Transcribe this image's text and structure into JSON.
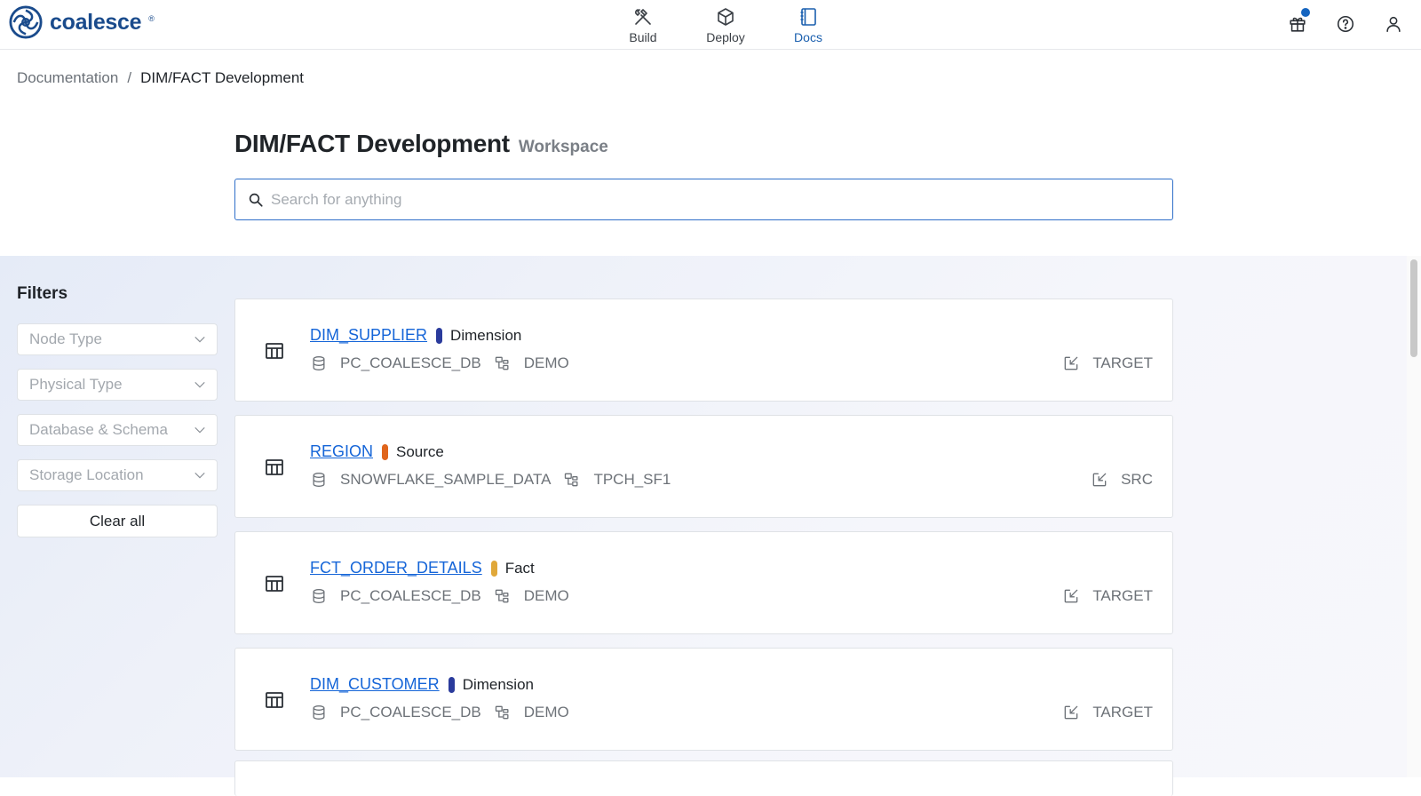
{
  "brand": {
    "name": "coalesce",
    "reg": "®"
  },
  "nav": [
    {
      "label": "Build",
      "icon": "hammer-wrench-icon",
      "active": false
    },
    {
      "label": "Deploy",
      "icon": "box-icon",
      "active": false
    },
    {
      "label": "Docs",
      "icon": "docs-icon",
      "active": true
    }
  ],
  "top_right": [
    "gift-icon",
    "help-icon",
    "user-icon"
  ],
  "breadcrumb": {
    "root": "Documentation",
    "separator": "/",
    "current": "DIM/FACT Development"
  },
  "header": {
    "title": "DIM/FACT Development",
    "subtitle": "Workspace"
  },
  "search": {
    "placeholder": "Search for anything",
    "value": ""
  },
  "filters": {
    "title": "Filters",
    "selects": [
      "Node Type",
      "Physical Type",
      "Database & Schema",
      "Storage Location"
    ],
    "clear_label": "Clear all"
  },
  "nodes": [
    {
      "name": "DIM_SUPPLIER",
      "type": "Dimension",
      "type_color": "#2a3b9c",
      "database": "PC_COALESCE_DB",
      "schema": "DEMO",
      "location": "TARGET"
    },
    {
      "name": "REGION",
      "type": "Source",
      "type_color": "#e0651c",
      "database": "SNOWFLAKE_SAMPLE_DATA",
      "schema": "TPCH_SF1",
      "location": "SRC"
    },
    {
      "name": "FCT_ORDER_DETAILS",
      "type": "Fact",
      "type_color": "#e0a83a",
      "database": "PC_COALESCE_DB",
      "schema": "DEMO",
      "location": "TARGET"
    },
    {
      "name": "DIM_CUSTOMER",
      "type": "Dimension",
      "type_color": "#2a3b9c",
      "database": "PC_COALESCE_DB",
      "schema": "DEMO",
      "location": "TARGET"
    }
  ]
}
